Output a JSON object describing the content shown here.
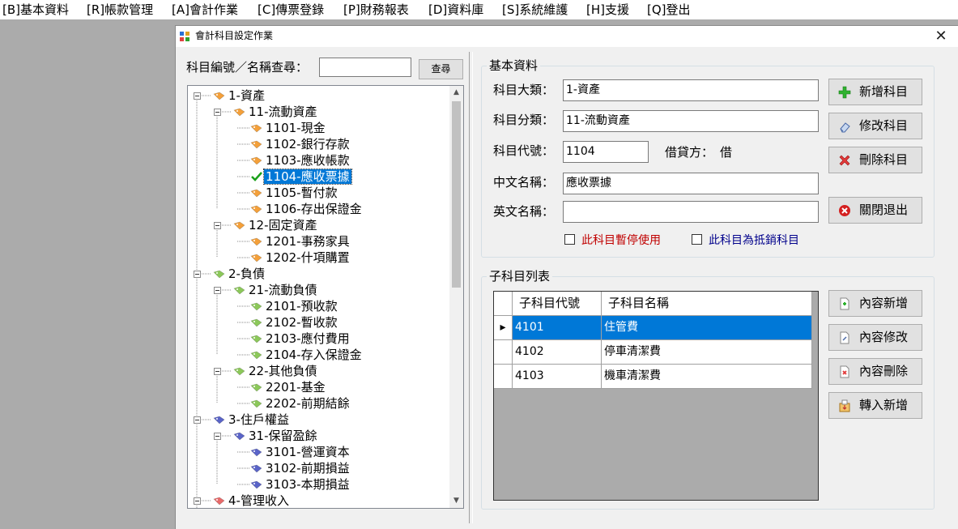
{
  "menu": [
    {
      "label": "[B]基本資料"
    },
    {
      "label": "[R]帳款管理"
    },
    {
      "label": "[A]會計作業"
    },
    {
      "label": "[C]傳票登錄"
    },
    {
      "label": "[P]財務報表"
    },
    {
      "label": "[D]資料庫"
    },
    {
      "label": "[S]系統維護"
    },
    {
      "label": "[H]支援"
    },
    {
      "label": "[Q]登出"
    }
  ],
  "window": {
    "title": "會計科目設定作業",
    "close_glyph": "✕"
  },
  "search": {
    "label": "科目編號／名稱查尋：",
    "value": "",
    "button": "查尋"
  },
  "tree": {
    "scroll_up": "▲",
    "scroll_down": "▼",
    "nodes": [
      {
        "label": "1-資產",
        "level": 0,
        "color": "#f4a03a",
        "expanded": true
      },
      {
        "label": "11-流動資產",
        "level": 1,
        "color": "#f4a03a",
        "expanded": true
      },
      {
        "label": "1101-現金",
        "level": 2,
        "color": "#f4a03a"
      },
      {
        "label": "1102-銀行存款",
        "level": 2,
        "color": "#f4a03a"
      },
      {
        "label": "1103-應收帳款",
        "level": 2,
        "color": "#f4a03a"
      },
      {
        "label": "1104-應收票據",
        "level": 2,
        "color": "#1aa01a",
        "selected": true,
        "check": true
      },
      {
        "label": "1105-暫付款",
        "level": 2,
        "color": "#f4a03a"
      },
      {
        "label": "1106-存出保證金",
        "level": 2,
        "color": "#f4a03a"
      },
      {
        "label": "12-固定資產",
        "level": 1,
        "color": "#f4a03a",
        "expanded": true
      },
      {
        "label": "1201-事務家具",
        "level": 2,
        "color": "#f4a03a"
      },
      {
        "label": "1202-什項購置",
        "level": 2,
        "color": "#f4a03a"
      },
      {
        "label": "2-負債",
        "level": 0,
        "color": "#8cc85a",
        "expanded": true
      },
      {
        "label": "21-流動負債",
        "level": 1,
        "color": "#8cc85a",
        "expanded": true
      },
      {
        "label": "2101-預收款",
        "level": 2,
        "color": "#8cc85a"
      },
      {
        "label": "2102-暫收款",
        "level": 2,
        "color": "#8cc85a"
      },
      {
        "label": "2103-應付費用",
        "level": 2,
        "color": "#8cc85a"
      },
      {
        "label": "2104-存入保證金",
        "level": 2,
        "color": "#8cc85a"
      },
      {
        "label": "22-其他負債",
        "level": 1,
        "color": "#8cc85a",
        "expanded": true
      },
      {
        "label": "2201-基金",
        "level": 2,
        "color": "#8cc85a"
      },
      {
        "label": "2202-前期結餘",
        "level": 2,
        "color": "#8cc85a"
      },
      {
        "label": "3-住戶權益",
        "level": 0,
        "color": "#5a64c8",
        "expanded": true
      },
      {
        "label": "31-保留盈餘",
        "level": 1,
        "color": "#5a64c8",
        "expanded": true
      },
      {
        "label": "3101-營運資本",
        "level": 2,
        "color": "#5a64c8"
      },
      {
        "label": "3102-前期損益",
        "level": 2,
        "color": "#5a64c8"
      },
      {
        "label": "3103-本期損益",
        "level": 2,
        "color": "#5a64c8"
      },
      {
        "label": "4-管理收入",
        "level": 0,
        "color": "#e86a6a",
        "expanded": true
      }
    ]
  },
  "basic": {
    "title": "基本資料",
    "major_label": "科目大類：",
    "major_value": "1-資產",
    "category_label": "科目分類：",
    "category_value": "11-流動資產",
    "code_label": "科目代號：",
    "code_value": "1104",
    "dc_label": "借貸方：",
    "dc_value": "借",
    "cname_label": "中文名稱：",
    "cname_value": "應收票據",
    "ename_label": "英文名稱：",
    "ename_value": "",
    "suspend_label": "此科目暫停使用",
    "suspend_color": "#c00000",
    "offset_label": "此科目為抵銷科目",
    "offset_color": "#00008b"
  },
  "actions": {
    "add": "新增科目",
    "edit": "修改科目",
    "delete": "刪除科目",
    "exit": "關閉退出"
  },
  "sub": {
    "title": "子科目列表",
    "headers": [
      "子科目代號",
      "子科目名稱"
    ],
    "rows": [
      {
        "code": "4101",
        "name": "住管費",
        "selected": true
      },
      {
        "code": "4102",
        "name": "停車清潔費"
      },
      {
        "code": "4103",
        "name": "機車清潔費"
      }
    ],
    "row_marker": "▸",
    "buttons": {
      "add": "內容新增",
      "edit": "內容修改",
      "delete": "內容刪除",
      "import": "轉入新增"
    }
  }
}
